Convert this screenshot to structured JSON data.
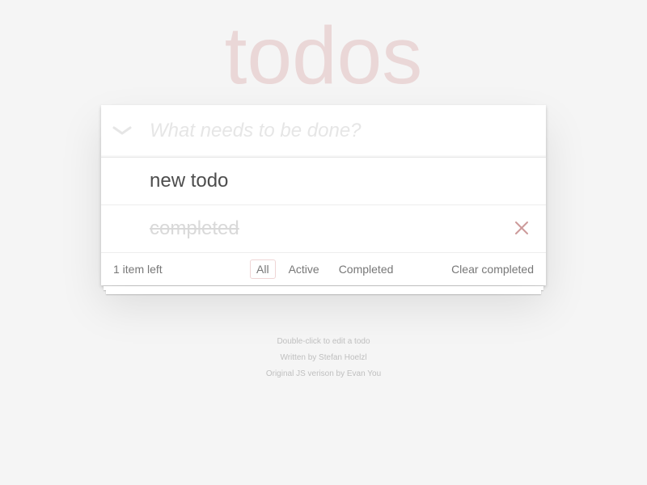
{
  "app": {
    "title": "todos"
  },
  "new_todo": {
    "placeholder": "What needs to be done?",
    "value": ""
  },
  "todos": [
    {
      "label": "new todo",
      "completed": false
    },
    {
      "label": "completed",
      "completed": true
    }
  ],
  "footer": {
    "count_text": "1 item left",
    "filters": [
      {
        "label": "All",
        "selected": true
      },
      {
        "label": "Active",
        "selected": false
      },
      {
        "label": "Completed",
        "selected": false
      }
    ],
    "clear_completed_label": "Clear completed"
  },
  "info": {
    "edit_hint": "Double-click to edit a todo",
    "written_by": "Written by Stefan Hoelzl",
    "original_by": "Original JS verison by Evan You"
  },
  "icons": {
    "toggle_all": "chevron-down-icon",
    "destroy": "close-icon"
  },
  "colors": {
    "accent": "#af2f2f",
    "background": "#f5f5f5",
    "destroy": "#cc9a9a"
  }
}
